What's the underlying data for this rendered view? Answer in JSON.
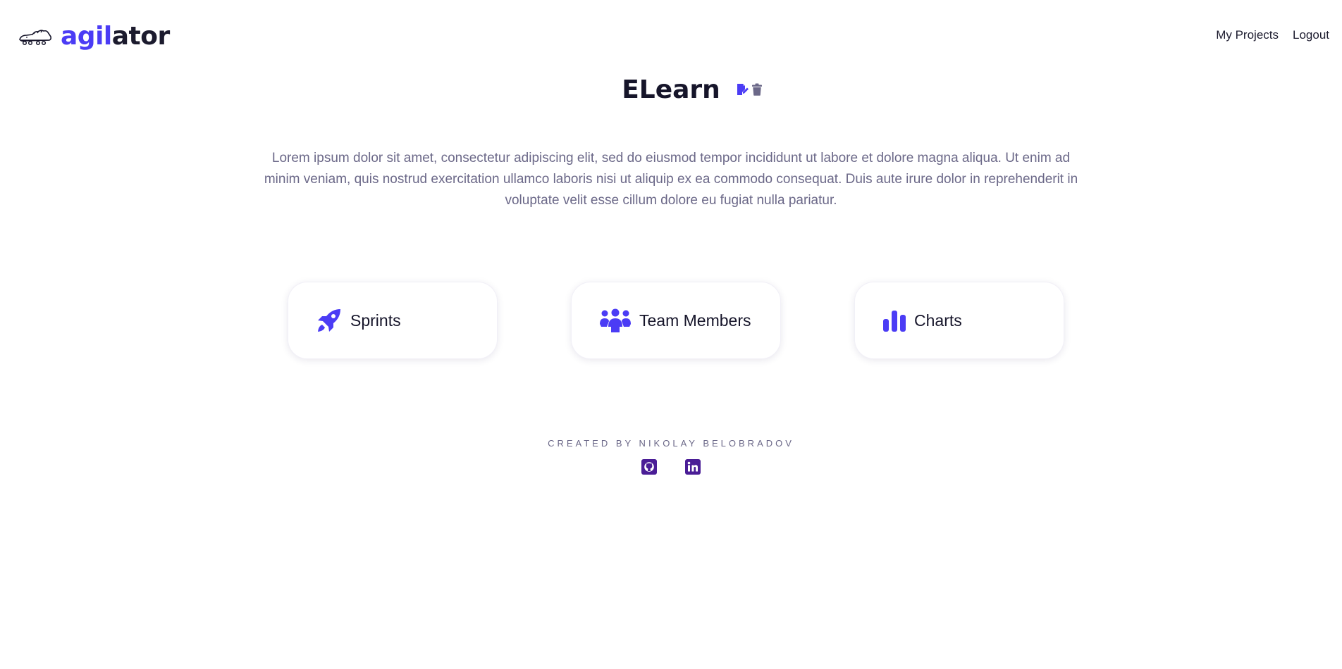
{
  "brand": {
    "name_accent": "agil",
    "name_rest": "ator",
    "accent_color": "#4b3cf5",
    "logo_icon": "crocodile-icon"
  },
  "nav": {
    "items": [
      {
        "label": "My Projects"
      },
      {
        "label": "Logout"
      }
    ]
  },
  "project": {
    "title": "ELearn",
    "actions": [
      {
        "icon": "edit-icon",
        "color": "#4b3cf5"
      },
      {
        "icon": "trash-icon",
        "color": "#6b6888"
      }
    ],
    "description": "Lorem ipsum dolor sit amet, consectetur adipiscing elit, sed do eiusmod tempor incididunt ut labore et dolore magna aliqua. Ut enim ad minim veniam, quis nostrud exercitation ullamco laboris nisi ut aliquip ex ea commodo consequat. Duis aute irure dolor in reprehenderit in voluptate velit esse cillum dolore eu fugiat nulla pariatur."
  },
  "cards": [
    {
      "label": "Sprints",
      "icon": "rocket-icon"
    },
    {
      "label": "Team Members",
      "icon": "users-icon"
    },
    {
      "label": "Charts",
      "icon": "bar-chart-icon"
    }
  ],
  "footer": {
    "credit": "CREATED BY NIKOLAY BELOBRADOV",
    "social": [
      {
        "icon": "github-icon"
      },
      {
        "icon": "linkedin-icon"
      }
    ],
    "social_color": "#4a1d96"
  }
}
